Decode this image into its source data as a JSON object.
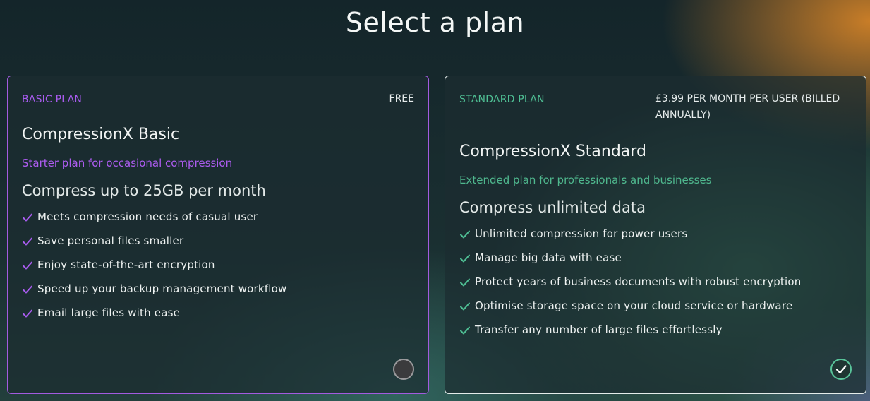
{
  "page": {
    "title": "Select a plan"
  },
  "plans": [
    {
      "label": "BASIC PLAN",
      "price": "FREE",
      "name": "CompressionX Basic",
      "description": "Starter plan for occasional compression",
      "headline": "Compress up to 25GB per month",
      "features": [
        "Meets compression needs of casual user",
        "Save personal files smaller",
        "Enjoy state-of-the-art encryption",
        "Speed up your backup management workflow",
        "Email large files with ease"
      ],
      "selected": false,
      "accent_color": "#a95cf0",
      "check_icon": "check-icon"
    },
    {
      "label": "STANDARD PLAN",
      "price": "£3.99 PER MONTH PER USER (BILLED ANNUALLY)",
      "name": "CompressionX Standard",
      "description": "Extended plan for professionals and businesses",
      "headline": "Compress unlimited data",
      "features": [
        "Unlimited compression for power users",
        "Manage big data with ease",
        "Protect years of business documents with robust encryption",
        "Optimise storage space on your cloud service or hardware",
        "Transfer any number of large files effortlessly"
      ],
      "selected": true,
      "accent_color": "#4fbf94",
      "check_icon": "check-icon"
    }
  ]
}
